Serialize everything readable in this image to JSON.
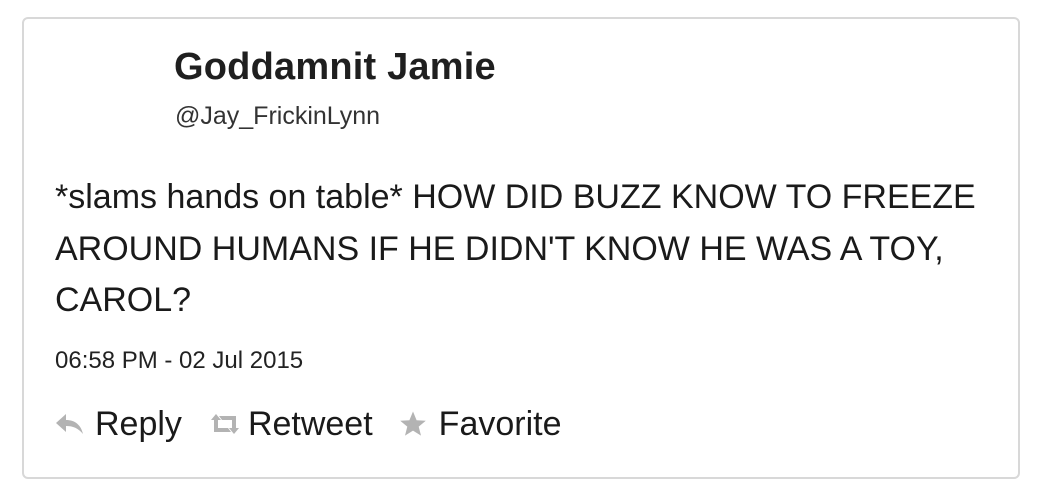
{
  "tweet": {
    "display_name": "Goddamnit Jamie",
    "handle": "@Jay_FrickinLynn",
    "text": "*slams hands on table* HOW DID BUZZ KNOW TO FREEZE AROUND HUMANS IF HE DIDN'T KNOW HE WAS A TOY, CAROL?",
    "timestamp": "06:58 PM - 02 Jul 2015"
  },
  "actions": {
    "reply_label": "Reply",
    "retweet_label": "Retweet",
    "favorite_label": "Favorite"
  },
  "icons": {
    "reply": "reply-arrow-icon",
    "retweet": "retweet-arrows-icon",
    "favorite": "star-icon"
  },
  "colors": {
    "icon_gray": "#b3b3b3",
    "border": "#d8d8d8",
    "text": "#1a1a1a"
  }
}
